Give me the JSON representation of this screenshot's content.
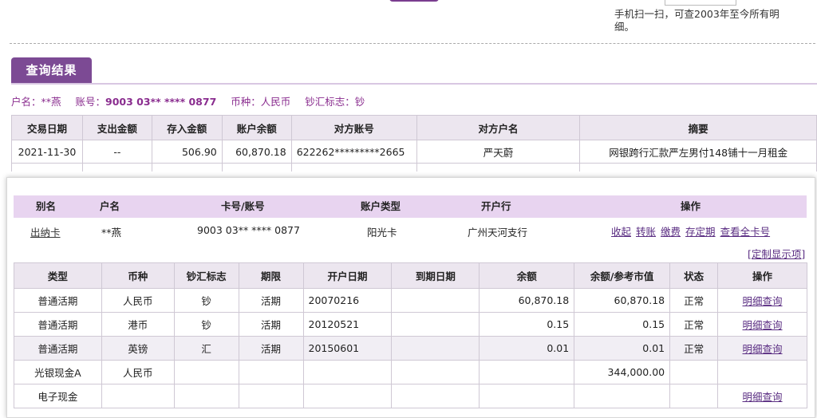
{
  "qr_hint": "手机扫一扫，可查2003年至今所有明细。",
  "result_tab": "查询结果",
  "account_info": {
    "holder": "户名：**燕",
    "account_label": "账号：",
    "account_no": "9003 03** **** 0877",
    "currency": "币种：人民币",
    "cash_flag": "钞汇标志：钞"
  },
  "tx_table": {
    "headers": [
      "交易日期",
      "支出金额",
      "存入金额",
      "账户余额",
      "对方账号",
      "对方户名",
      "摘要"
    ],
    "rows": [
      [
        "2021-11-30",
        "--",
        "506.90",
        "60,870.18",
        "622262*********2665",
        "严天蔚",
        "网银跨行汇款严左男付148铺十一月租金"
      ]
    ]
  },
  "card": {
    "headers": {
      "alias": "别名",
      "holder": "户名",
      "card_no": "卡号/账号",
      "type": "账户类型",
      "branch": "开户行",
      "ops": "操作"
    },
    "row": {
      "alias": "出纳卡",
      "holder": "**燕",
      "card_no": "9003 03** **** 0877",
      "type": "阳光卡",
      "branch": "广州天河支行"
    },
    "ops": [
      "收起",
      "转账",
      "缴费",
      "存定期",
      "查看全卡号"
    ],
    "custom_link": "[定制显示项]"
  },
  "balance_table": {
    "headers": [
      "类型",
      "币种",
      "钞汇标志",
      "期限",
      "开户日期",
      "到期日期",
      "余额",
      "余额/参考市值",
      "状态",
      "操作"
    ],
    "rows": [
      [
        "普通活期",
        "人民币",
        "钞",
        "活期",
        "20070216",
        "",
        "60,870.18",
        "60,870.18",
        "正常",
        "明细查询"
      ],
      [
        "普通活期",
        "港币",
        "钞",
        "活期",
        "20120521",
        "",
        "0.15",
        "0.15",
        "正常",
        "明细查询"
      ],
      [
        "普通活期",
        "英镑",
        "汇",
        "活期",
        "20150601",
        "",
        "0.01",
        "0.01",
        "正常",
        "明细查询"
      ],
      [
        "光银现金A",
        "人民币",
        "",
        "",
        "",
        "",
        "",
        "344,000.00",
        "",
        ""
      ],
      [
        "电子现金",
        "",
        "",
        "",
        "",
        "",
        "",
        "",
        "",
        "明细查询"
      ]
    ]
  }
}
